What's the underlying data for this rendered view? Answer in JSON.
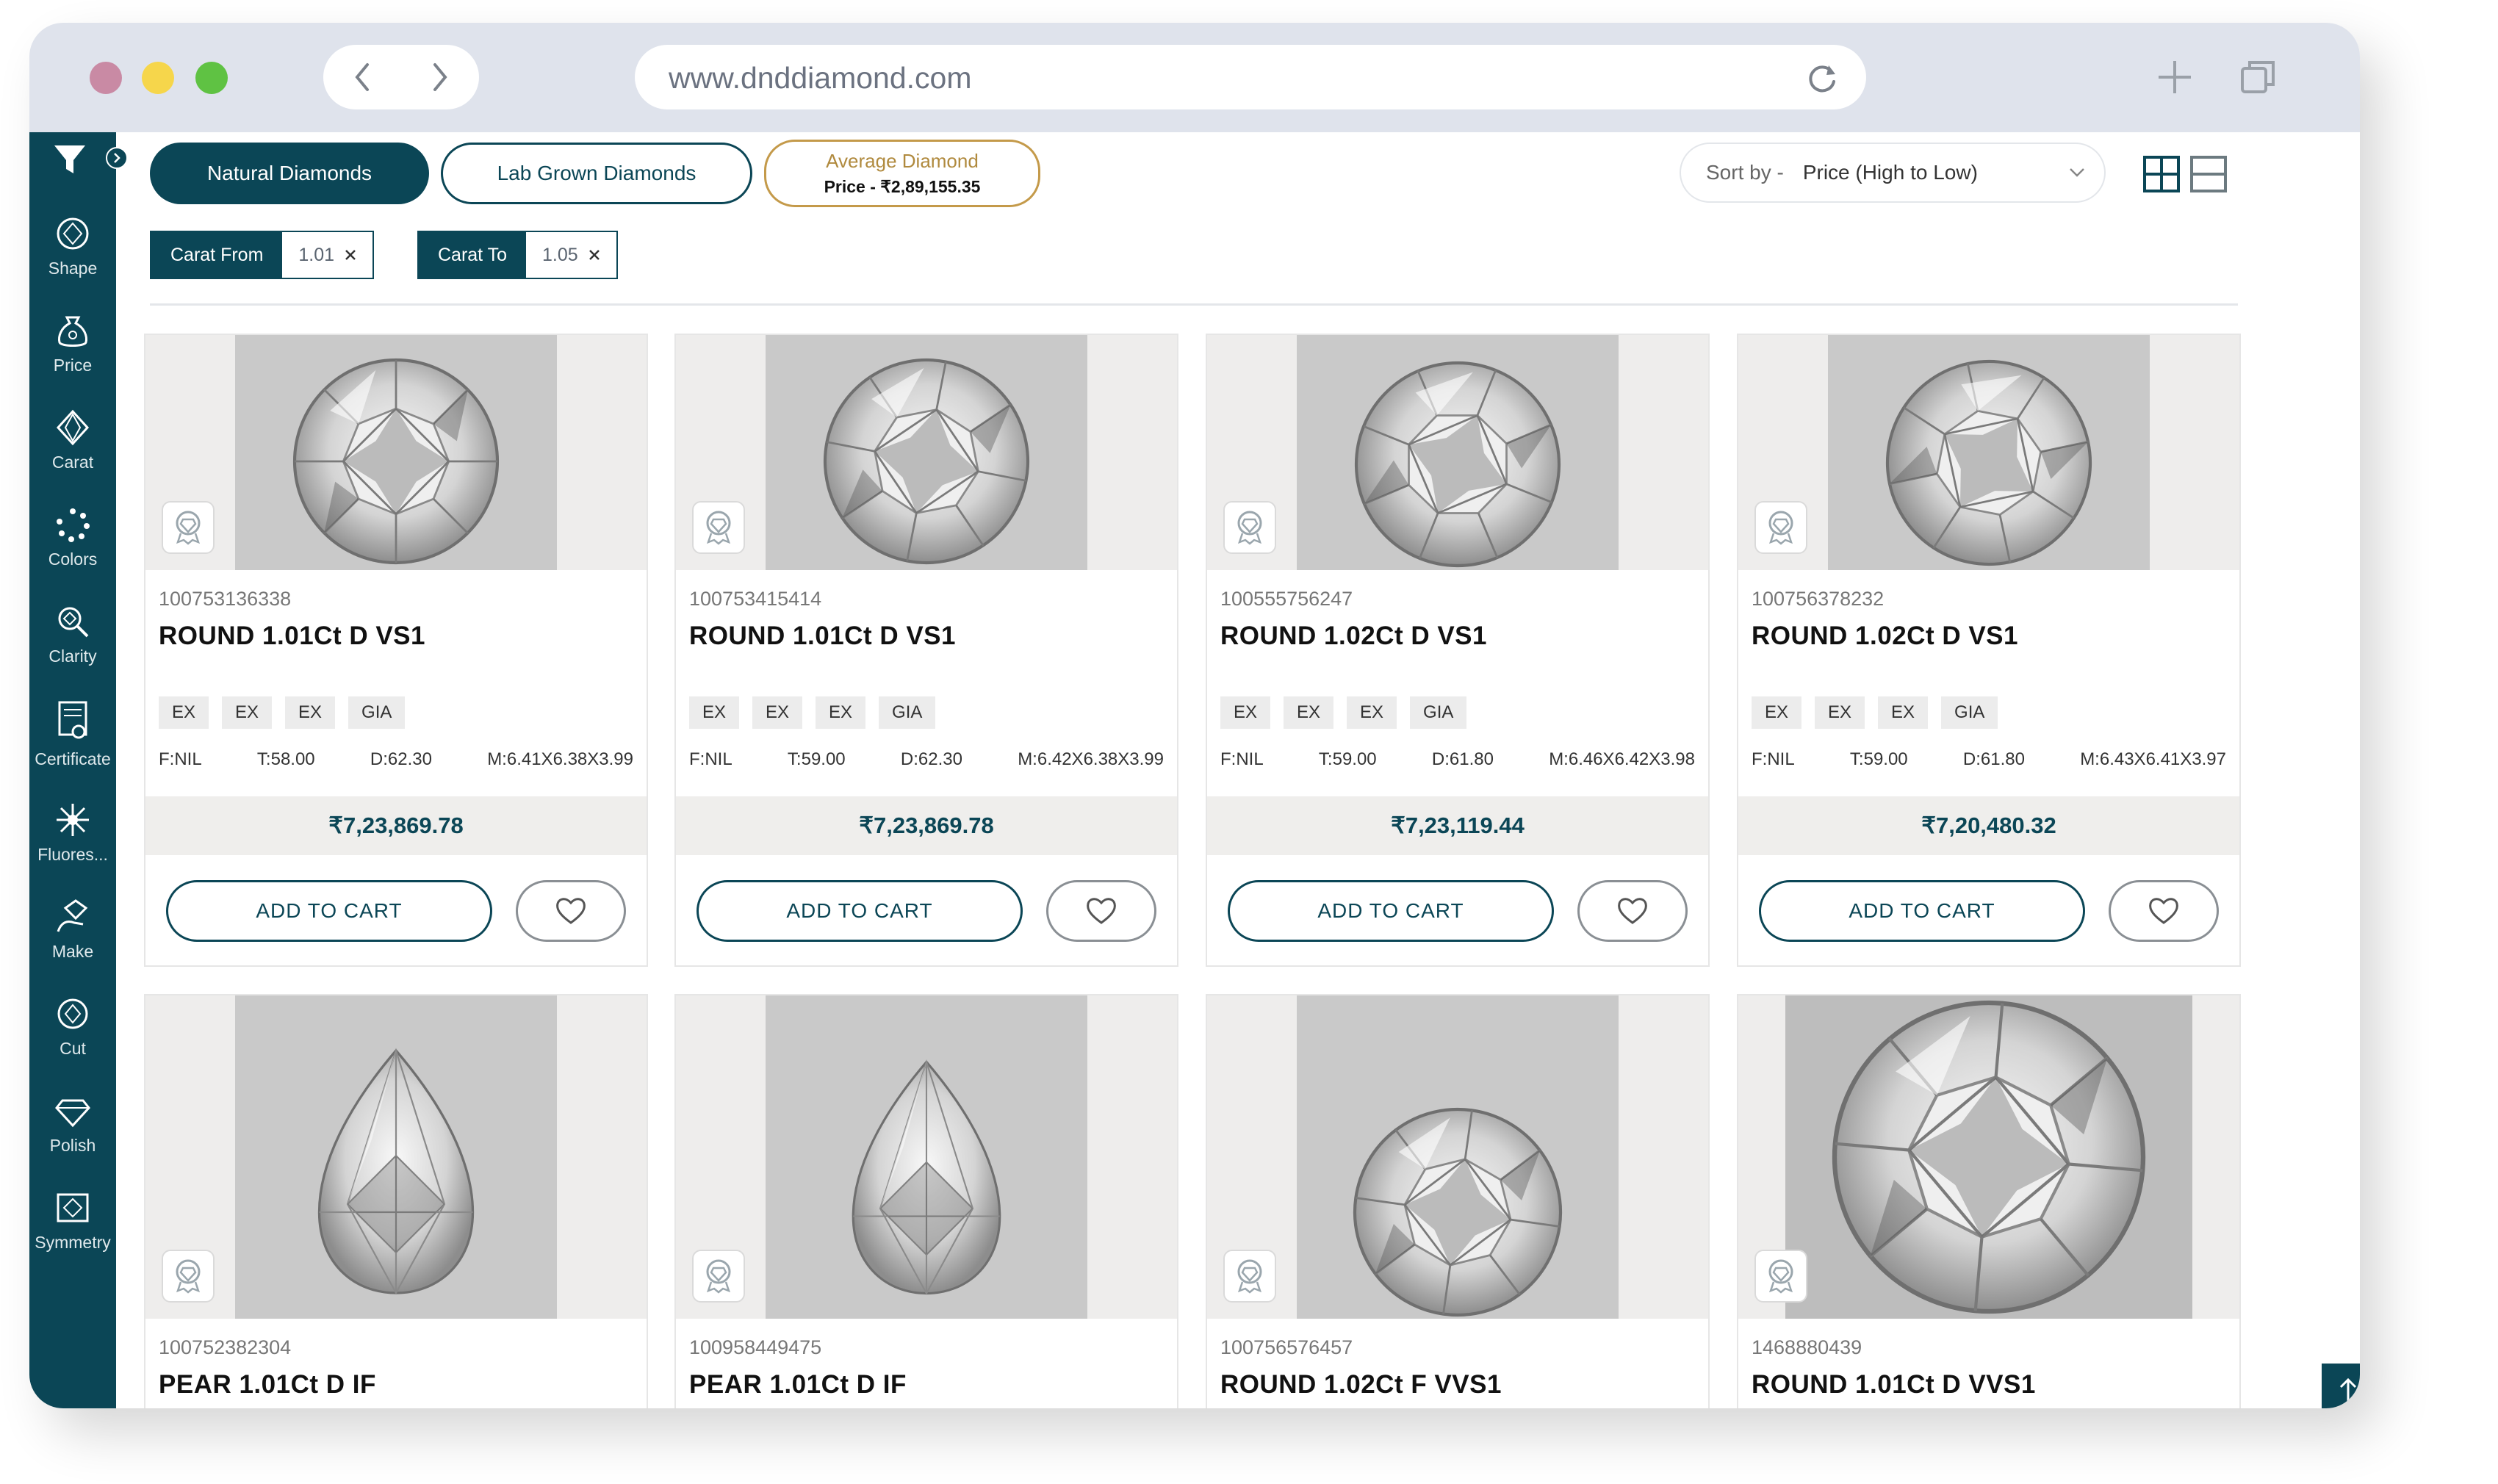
{
  "browser": {
    "url": "www.dnddiamond.com",
    "icons": {
      "back": "chevron-left-icon",
      "forward": "chevron-right-icon",
      "reload": "reload-icon",
      "new_tab": "plus-icon",
      "tabs": "tabs-icon"
    },
    "traffic_lights": [
      "#c98aa4",
      "#f6d64b",
      "#5fc243"
    ]
  },
  "sidebar": {
    "items": [
      {
        "label": "Shape",
        "icon": "diamond-shape-icon"
      },
      {
        "label": "Price",
        "icon": "money-bag-icon"
      },
      {
        "label": "Carat",
        "icon": "carat-icon"
      },
      {
        "label": "Colors",
        "icon": "color-dots-icon"
      },
      {
        "label": "Clarity",
        "icon": "magnifier-icon"
      },
      {
        "label": "Certificate",
        "icon": "certificate-icon"
      },
      {
        "label": "Fluores...",
        "icon": "sparkle-icon"
      },
      {
        "label": "Make",
        "icon": "hand-diamond-icon"
      },
      {
        "label": "Cut",
        "icon": "cut-icon"
      },
      {
        "label": "Polish",
        "icon": "polish-icon"
      },
      {
        "label": "Symmetry",
        "icon": "symmetry-icon"
      }
    ]
  },
  "toolbar": {
    "natural": "Natural Diamonds",
    "lab": "Lab Grown Diamonds",
    "average_title": "Average Diamond",
    "average_price": "Price - ₹2,89,155.35",
    "sort_prefix": "Sort by -",
    "sort_value": "Price (High to Low)"
  },
  "filters": {
    "carat_from_label": "Carat From",
    "carat_from_value": "1.01",
    "carat_to_label": "Carat To",
    "carat_to_value": "1.05"
  },
  "actions": {
    "add_to_cart": "ADD TO CART"
  },
  "colors": {
    "primary": "#0b4656",
    "gold": "#b08a3e"
  },
  "products": [
    {
      "id": "100753136338",
      "name": "ROUND 1.01Ct D VS1",
      "tags": [
        "EX",
        "EX",
        "EX",
        "GIA"
      ],
      "f": "F:NIL",
      "t": "T:58.00",
      "d": "D:62.30",
      "m": "M:6.41X6.38X3.99",
      "price": "₹7,23,869.78"
    },
    {
      "id": "100753415414",
      "name": "ROUND 1.01Ct D VS1",
      "tags": [
        "EX",
        "EX",
        "EX",
        "GIA"
      ],
      "f": "F:NIL",
      "t": "T:59.00",
      "d": "D:62.30",
      "m": "M:6.42X6.38X3.99",
      "price": "₹7,23,869.78"
    },
    {
      "id": "100555756247",
      "name": "ROUND 1.02Ct D VS1",
      "tags": [
        "EX",
        "EX",
        "EX",
        "GIA"
      ],
      "f": "F:NIL",
      "t": "T:59.00",
      "d": "D:61.80",
      "m": "M:6.46X6.42X3.98",
      "price": "₹7,23,119.44"
    },
    {
      "id": "100756378232",
      "name": "ROUND 1.02Ct D VS1",
      "tags": [
        "EX",
        "EX",
        "EX",
        "GIA"
      ],
      "f": "F:NIL",
      "t": "T:59.00",
      "d": "D:61.80",
      "m": "M:6.43X6.41X3.97",
      "price": "₹7,20,480.32"
    },
    {
      "id": "100752382304",
      "name": "PEAR 1.01Ct D IF"
    },
    {
      "id": "100958449475",
      "name": "PEAR 1.01Ct D IF"
    },
    {
      "id": "100756576457",
      "name": "ROUND 1.02Ct F VVS1"
    },
    {
      "id": "1468880439",
      "name": "ROUND 1.01Ct D VVS1"
    }
  ]
}
